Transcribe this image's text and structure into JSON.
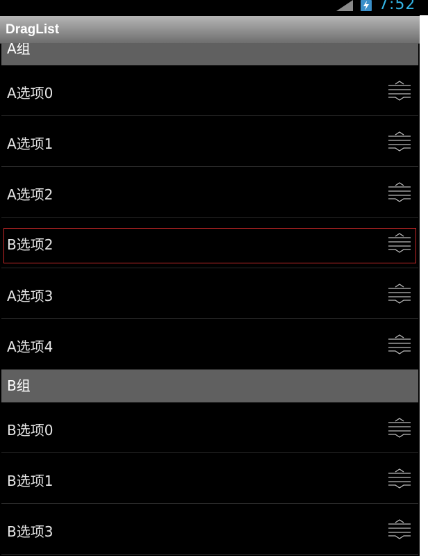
{
  "status_bar": {
    "time": "7:52",
    "signal_icon": "signal-icon",
    "battery_icon": "battery-charging-icon",
    "accent": "#33b5e5"
  },
  "app": {
    "title": "DragList"
  },
  "groups": [
    {
      "header": "A组",
      "items": [
        "A选项0",
        "A选项1",
        "A选项2",
        "B选项2",
        "A选项3",
        "A选项4"
      ],
      "dragging_item": "B选项2"
    },
    {
      "header": "B组",
      "items": [
        "B选项0",
        "B选项1",
        "B选项3"
      ]
    }
  ],
  "colors": {
    "background": "#000000",
    "group_header": "#606060",
    "drag_highlight": "#c62828"
  },
  "icons": {
    "row_handle": "drag-handle-icon"
  }
}
